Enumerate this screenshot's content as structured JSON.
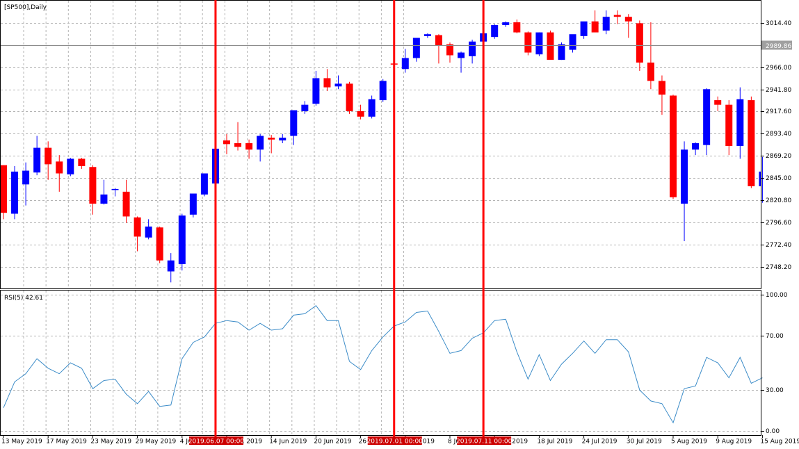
{
  "chart_data": [
    {
      "type": "candlestick",
      "title": "[SP500],Daily",
      "ylim": [
        2724.4,
        3038.6
      ],
      "y_ticks": [
        "3014.40",
        "2990.00",
        "2966.00",
        "2941.80",
        "2917.60",
        "2893.40",
        "2869.20",
        "2845.00",
        "2820.80",
        "2796.60",
        "2772.40",
        "2748.20"
      ],
      "current_price_label": "2989.86",
      "current_price": 2989.86,
      "bull_color": "#0000ff",
      "bear_color": "#ff0000",
      "candles": [
        {
          "o": 2859,
          "h": 2859,
          "l": 2800,
          "c": 2807
        },
        {
          "o": 2806,
          "h": 2858,
          "l": 2800,
          "c": 2852
        },
        {
          "o": 2838,
          "h": 2862,
          "l": 2815,
          "c": 2853
        },
        {
          "o": 2851,
          "h": 2891,
          "l": 2848,
          "c": 2878
        },
        {
          "o": 2878,
          "h": 2885,
          "l": 2843,
          "c": 2860
        },
        {
          "o": 2863,
          "h": 2870,
          "l": 2830,
          "c": 2850
        },
        {
          "o": 2849,
          "h": 2867,
          "l": 2847,
          "c": 2866
        },
        {
          "o": 2866,
          "h": 2867,
          "l": 2855,
          "c": 2858
        },
        {
          "o": 2857,
          "h": 2859,
          "l": 2805,
          "c": 2817
        },
        {
          "o": 2817,
          "h": 2843,
          "l": 2816,
          "c": 2827
        },
        {
          "o": 2833,
          "h": 2834,
          "l": 2825,
          "c": 2833
        },
        {
          "o": 2830,
          "h": 2843,
          "l": 2796,
          "c": 2803
        },
        {
          "o": 2802,
          "h": 2803,
          "l": 2765,
          "c": 2781
        },
        {
          "o": 2780,
          "h": 2800,
          "l": 2778,
          "c": 2792
        },
        {
          "o": 2791,
          "h": 2792,
          "l": 2752,
          "c": 2755
        },
        {
          "o": 2743,
          "h": 2763,
          "l": 2731,
          "c": 2755
        },
        {
          "o": 2751,
          "h": 2806,
          "l": 2744,
          "c": 2804
        },
        {
          "o": 2805,
          "h": 2827,
          "l": 2802,
          "c": 2828
        },
        {
          "o": 2827,
          "h": 2850,
          "l": 2825,
          "c": 2850
        },
        {
          "o": 2839,
          "h": 2879,
          "l": 2838,
          "c": 2877
        },
        {
          "o": 2886,
          "h": 2893,
          "l": 2871,
          "c": 2882
        },
        {
          "o": 2883,
          "h": 2906,
          "l": 2875,
          "c": 2879
        },
        {
          "o": 2883,
          "h": 2887,
          "l": 2866,
          "c": 2876
        },
        {
          "o": 2876,
          "h": 2893,
          "l": 2863,
          "c": 2891
        },
        {
          "o": 2889,
          "h": 2892,
          "l": 2872,
          "c": 2887
        },
        {
          "o": 2886,
          "h": 2893,
          "l": 2883,
          "c": 2889
        },
        {
          "o": 2891,
          "h": 2915,
          "l": 2881,
          "c": 2919
        },
        {
          "o": 2918,
          "h": 2929,
          "l": 2915,
          "c": 2925
        },
        {
          "o": 2926,
          "h": 2962,
          "l": 2924,
          "c": 2954
        },
        {
          "o": 2954,
          "h": 2964,
          "l": 2940,
          "c": 2944
        },
        {
          "o": 2945,
          "h": 2957,
          "l": 2942,
          "c": 2948
        },
        {
          "o": 2948,
          "h": 2950,
          "l": 2915,
          "c": 2918
        },
        {
          "o": 2918,
          "h": 2925,
          "l": 2909,
          "c": 2912
        },
        {
          "o": 2912,
          "h": 2935,
          "l": 2910,
          "c": 2931
        },
        {
          "o": 2930,
          "h": 2953,
          "l": 2928,
          "c": 2951
        },
        {
          "o": 2970,
          "h": 2972,
          "l": 2968,
          "c": 2969
        },
        {
          "o": 2964,
          "h": 2986,
          "l": 2960,
          "c": 2976
        },
        {
          "o": 2976,
          "h": 2998,
          "l": 2972,
          "c": 2998
        },
        {
          "o": 3000,
          "h": 3003,
          "l": 2998,
          "c": 3002
        },
        {
          "o": 3001,
          "h": 3002,
          "l": 2970,
          "c": 2990
        },
        {
          "o": 2991,
          "h": 2993,
          "l": 2971,
          "c": 2979
        },
        {
          "o": 2976,
          "h": 2983,
          "l": 2960,
          "c": 2982
        },
        {
          "o": 2978,
          "h": 2996,
          "l": 2970,
          "c": 2994
        },
        {
          "o": 2994,
          "h": 3006,
          "l": 2970,
          "c": 3003
        },
        {
          "o": 2999,
          "h": 3013,
          "l": 2997,
          "c": 3012
        },
        {
          "o": 3012,
          "h": 3016,
          "l": 3010,
          "c": 3015
        },
        {
          "o": 3015,
          "h": 3018,
          "l": 3003,
          "c": 3004
        },
        {
          "o": 3004,
          "h": 3005,
          "l": 2979,
          "c": 2982
        },
        {
          "o": 2980,
          "h": 3004,
          "l": 2978,
          "c": 3004
        },
        {
          "o": 3004,
          "h": 3006,
          "l": 2975,
          "c": 2974
        },
        {
          "o": 2974,
          "h": 2993,
          "l": 2974,
          "c": 2991
        },
        {
          "o": 2985,
          "h": 3000,
          "l": 2982,
          "c": 3002
        },
        {
          "o": 3000,
          "h": 3015,
          "l": 2997,
          "c": 3016
        },
        {
          "o": 3016,
          "h": 3028,
          "l": 3006,
          "c": 3004
        },
        {
          "o": 3006,
          "h": 3028,
          "l": 3002,
          "c": 3021
        },
        {
          "o": 3023,
          "h": 3028,
          "l": 3013,
          "c": 3021
        },
        {
          "o": 3021,
          "h": 3024,
          "l": 2998,
          "c": 3016
        },
        {
          "o": 3014,
          "h": 3017,
          "l": 2962,
          "c": 2971
        },
        {
          "o": 2971,
          "h": 3015,
          "l": 2942,
          "c": 2951
        },
        {
          "o": 2951,
          "h": 2957,
          "l": 2914,
          "c": 2936
        },
        {
          "o": 2935,
          "h": 2936,
          "l": 2822,
          "c": 2824
        },
        {
          "o": 2817,
          "h": 2885,
          "l": 2776,
          "c": 2876
        },
        {
          "o": 2876,
          "h": 2884,
          "l": 2870,
          "c": 2883
        },
        {
          "o": 2881,
          "h": 2943,
          "l": 2870,
          "c": 2942
        },
        {
          "o": 2930,
          "h": 2934,
          "l": 2918,
          "c": 2925
        },
        {
          "o": 2925,
          "h": 2930,
          "l": 2870,
          "c": 2880
        },
        {
          "o": 2880,
          "h": 2944,
          "l": 2866,
          "c": 2931
        },
        {
          "o": 2930,
          "h": 2934,
          "l": 2834,
          "c": 2836
        },
        {
          "o": 2836,
          "h": 2868,
          "l": 2818,
          "c": 2852
        }
      ]
    },
    {
      "type": "line",
      "title": "RSI(5) 42.61",
      "ylim": [
        0,
        100
      ],
      "y_ticks": [
        "100.00",
        "70.00",
        "30.00",
        "0.00"
      ],
      "y_tick_values": [
        100,
        70,
        30,
        0
      ],
      "color": "#3c8cc8",
      "values": [
        17,
        36,
        42,
        53,
        46,
        42,
        50,
        46,
        31,
        37,
        38,
        27,
        20,
        29,
        18,
        19,
        53,
        65,
        69,
        79,
        81,
        80,
        74,
        79,
        74,
        75,
        85,
        86,
        92,
        81,
        81,
        51,
        45,
        59,
        69,
        77,
        80,
        87,
        88,
        73,
        57,
        59,
        68,
        72,
        81,
        82,
        58,
        38,
        56,
        37,
        49,
        57,
        66,
        57,
        67,
        67,
        58,
        30,
        22,
        20,
        6,
        31,
        33,
        54,
        50,
        39,
        54,
        35,
        39
      ]
    }
  ],
  "x_axis": {
    "labels": [
      "13 May 2019",
      "17 May 2019",
      "23 May 2019",
      "29 May 2019",
      "4 Jun 2019",
      "10 Jun 2019",
      "14 Jun 2019",
      "20 Jun 2019",
      "26 Jun 2019",
      "2 Jul 2019",
      "8 Jul 2019",
      "12 Jul 2019",
      "18 Jul 2019",
      "24 Jul 2019",
      "30 Jul 2019",
      "5 Aug 2019",
      "9 Aug 2019",
      "15 Aug 2019"
    ],
    "label_indices": [
      0,
      4,
      8,
      12,
      16,
      20,
      24,
      28,
      32,
      36,
      40,
      44,
      48,
      52,
      56,
      60,
      64,
      68
    ]
  },
  "markers": [
    {
      "label": "2019.06.07 00:00",
      "index": 19
    },
    {
      "label": "2019.07.01 00:00",
      "index": 35
    },
    {
      "label": "2019.07.11 00:00",
      "index": 43
    }
  ],
  "colors": {
    "marker": "#ff0000",
    "marker_label_bg": "#cc0000",
    "marker_label_text": "#ffffff",
    "grid": "#b4b4b4",
    "price_line": "#8c8c8c",
    "price_label_bg": "#a0a0a0"
  }
}
